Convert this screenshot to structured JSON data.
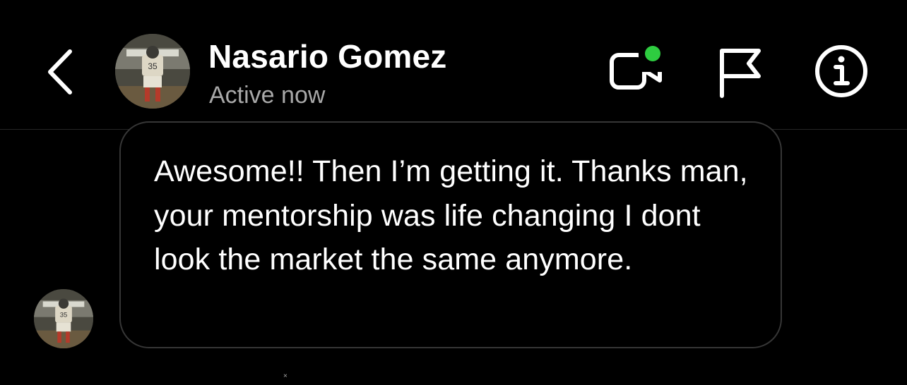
{
  "header": {
    "contact_name": "Nasario Gomez",
    "status": "Active now",
    "icons": {
      "back": "chevron-left-icon",
      "video": "video-camera-icon",
      "flag": "flag-icon",
      "info": "info-icon"
    },
    "online_indicator_color": "#2ecc40"
  },
  "conversation": {
    "messages": [
      {
        "sender": "Nasario Gomez",
        "text": "Awesome!! Then I’m getting it. Thanks man, your mentorship was life changing I dont look the market the same anymore."
      }
    ],
    "footer_glyph": "×"
  },
  "colors": {
    "background": "#000000",
    "text_primary": "#ffffff",
    "text_secondary": "#a8a8a8",
    "bubble_border": "#363636"
  }
}
